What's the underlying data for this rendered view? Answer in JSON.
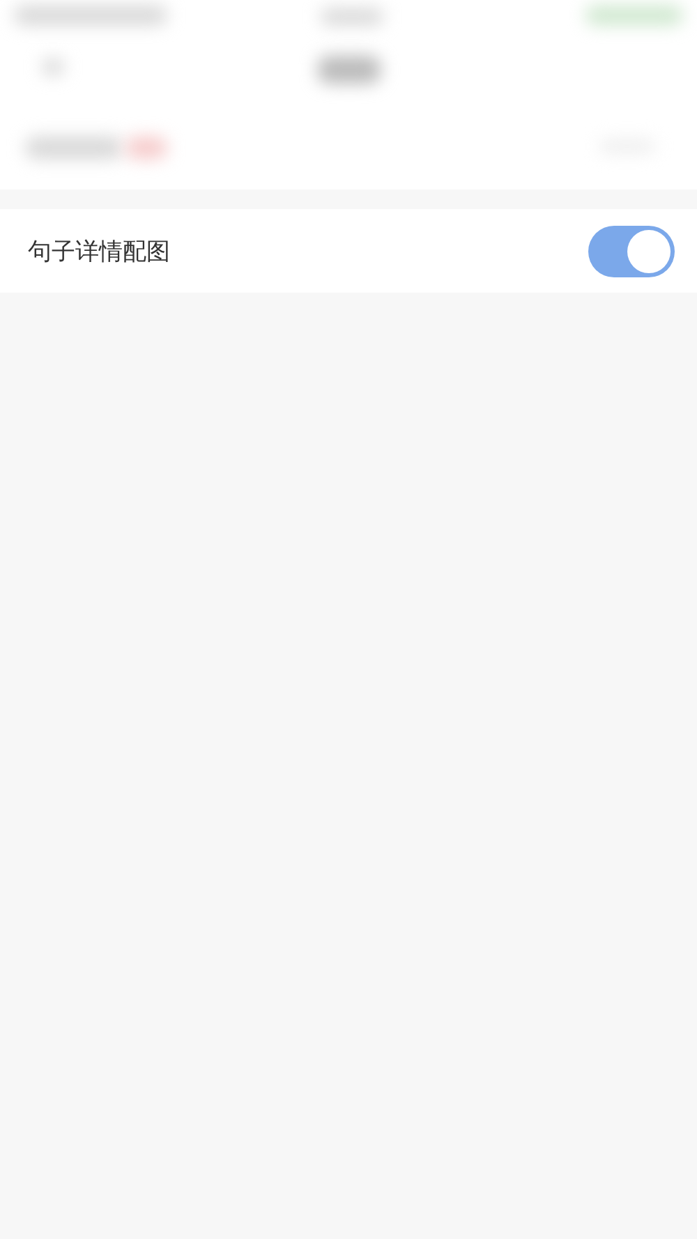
{
  "settings": [
    {
      "kind": "toggle",
      "label": "句子详情配图",
      "on": true
    }
  ]
}
